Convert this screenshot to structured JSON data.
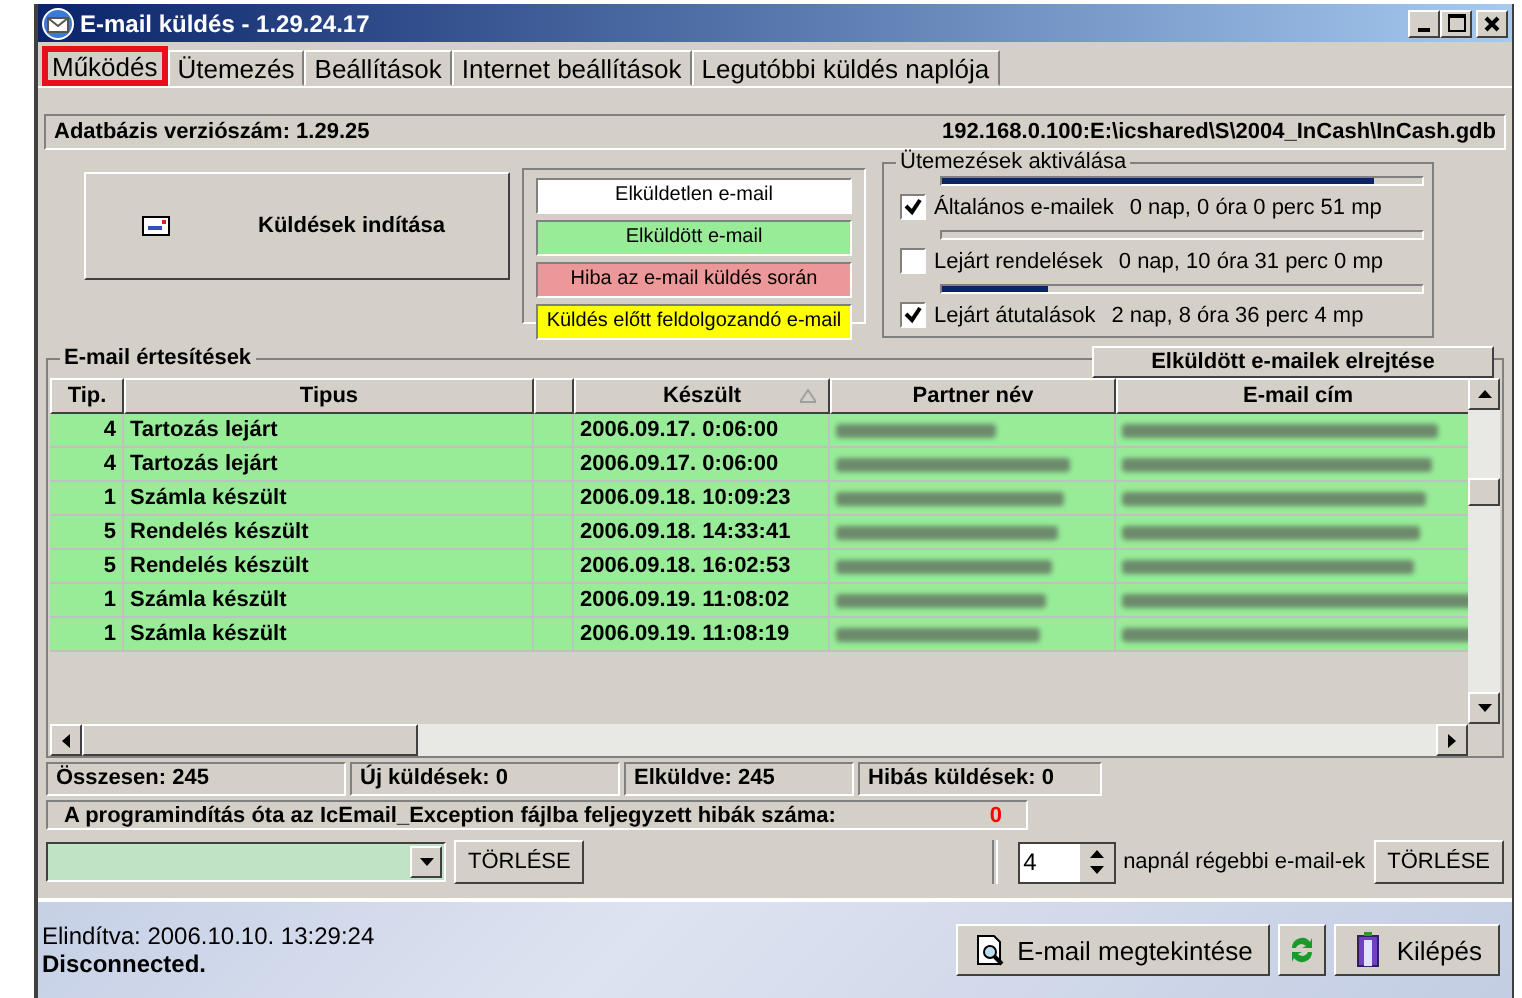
{
  "window": {
    "title": "E-mail küldés  -  1.29.24.17"
  },
  "tabs": [
    {
      "label": "Működés",
      "selected": true,
      "highlighted": true
    },
    {
      "label": "Ütemezés",
      "selected": false,
      "highlighted": false
    },
    {
      "label": "Beállítások",
      "selected": false,
      "highlighted": false
    },
    {
      "label": "Internet beállítások",
      "selected": false,
      "highlighted": false
    },
    {
      "label": "Legutóbbi küldés naplója",
      "selected": false,
      "highlighted": false
    }
  ],
  "db_bar": {
    "version": "Adatbázis verziószám: 1.29.25",
    "path": "192.168.0.100:E:\\icshared\\S\\2004_InCash\\InCash.gdb"
  },
  "start_button": {
    "label": "Küldések indítása"
  },
  "legend": [
    {
      "label": "Elküldetlen e-mail",
      "color": "#ffffff"
    },
    {
      "label": "Elküldött e-mail",
      "color": "#98ec98"
    },
    {
      "label": "Hiba az e-mail küldés során",
      "color": "#ec9898"
    },
    {
      "label": "Küldés előtt feldolgozandó e-mail",
      "color": "#ffff00"
    }
  ],
  "schedules": {
    "title": "Ütemezések aktiválása",
    "items": [
      {
        "label": "Általános e-mailek",
        "reading": "0 nap, 0 óra 0 perc 51 mp",
        "checked": true,
        "level": 0.9
      },
      {
        "label": "Lejárt rendelések",
        "reading": "0 nap, 10 óra 31 perc 0 mp",
        "checked": false,
        "level": 0
      },
      {
        "label": "Lejárt átutalások",
        "reading": "2 nap, 8 óra 36 perc 4 mp",
        "checked": true,
        "level": 0.22
      }
    ]
  },
  "notifications": {
    "title": "E-mail értesítések",
    "hide_button": "Elküldött e-mailek elrejtése",
    "columns": [
      {
        "label": "Tip.",
        "sorted": false
      },
      {
        "label": "Tipus",
        "sorted": false
      },
      {
        "sorted": false
      },
      {
        "label": "Készült",
        "sorted": true
      },
      {
        "label": "Partner név",
        "sorted": false
      },
      {
        "label": "E-mail cím",
        "sorted": false
      }
    ],
    "rows": [
      {
        "tip": "4",
        "type": "Tartozás lejárt",
        "created": "2006.09.17. 0:06:00"
      },
      {
        "tip": "4",
        "type": "Tartozás lejárt",
        "created": "2006.09.17. 0:06:00"
      },
      {
        "tip": "1",
        "type": "Számla készült",
        "created": "2006.09.18. 10:09:23"
      },
      {
        "tip": "5",
        "type": "Rendelés készült",
        "created": "2006.09.18. 14:33:41"
      },
      {
        "tip": "5",
        "type": "Rendelés készült",
        "created": "2006.09.18. 16:02:53"
      },
      {
        "tip": "1",
        "type": "Számla készült",
        "created": "2006.09.19. 11:08:02"
      },
      {
        "tip": "1",
        "type": "Számla készült",
        "created": "2006.09.19. 11:08:19"
      }
    ]
  },
  "summary": [
    "Összesen: 245",
    "Új küldések: 0",
    "Elküldve: 245",
    "Hibás küldések: 0"
  ],
  "error_line": {
    "label": "A programindítás óta az IcEmail_Exception fájlba feljegyzett hibák száma:",
    "count": "0"
  },
  "filter": {
    "clear_button": "TÖRLÉSE",
    "days": "4",
    "days_label": "napnál régebbi e-mail-ek",
    "clear_old_button": "TÖRLÉSE"
  },
  "status": {
    "started": "Elindítva: 2006.10.10. 13:29:24",
    "connection": "Disconnected."
  },
  "bottom_buttons": {
    "view": "E-mail megtekintése",
    "exit": "Kilépés"
  }
}
